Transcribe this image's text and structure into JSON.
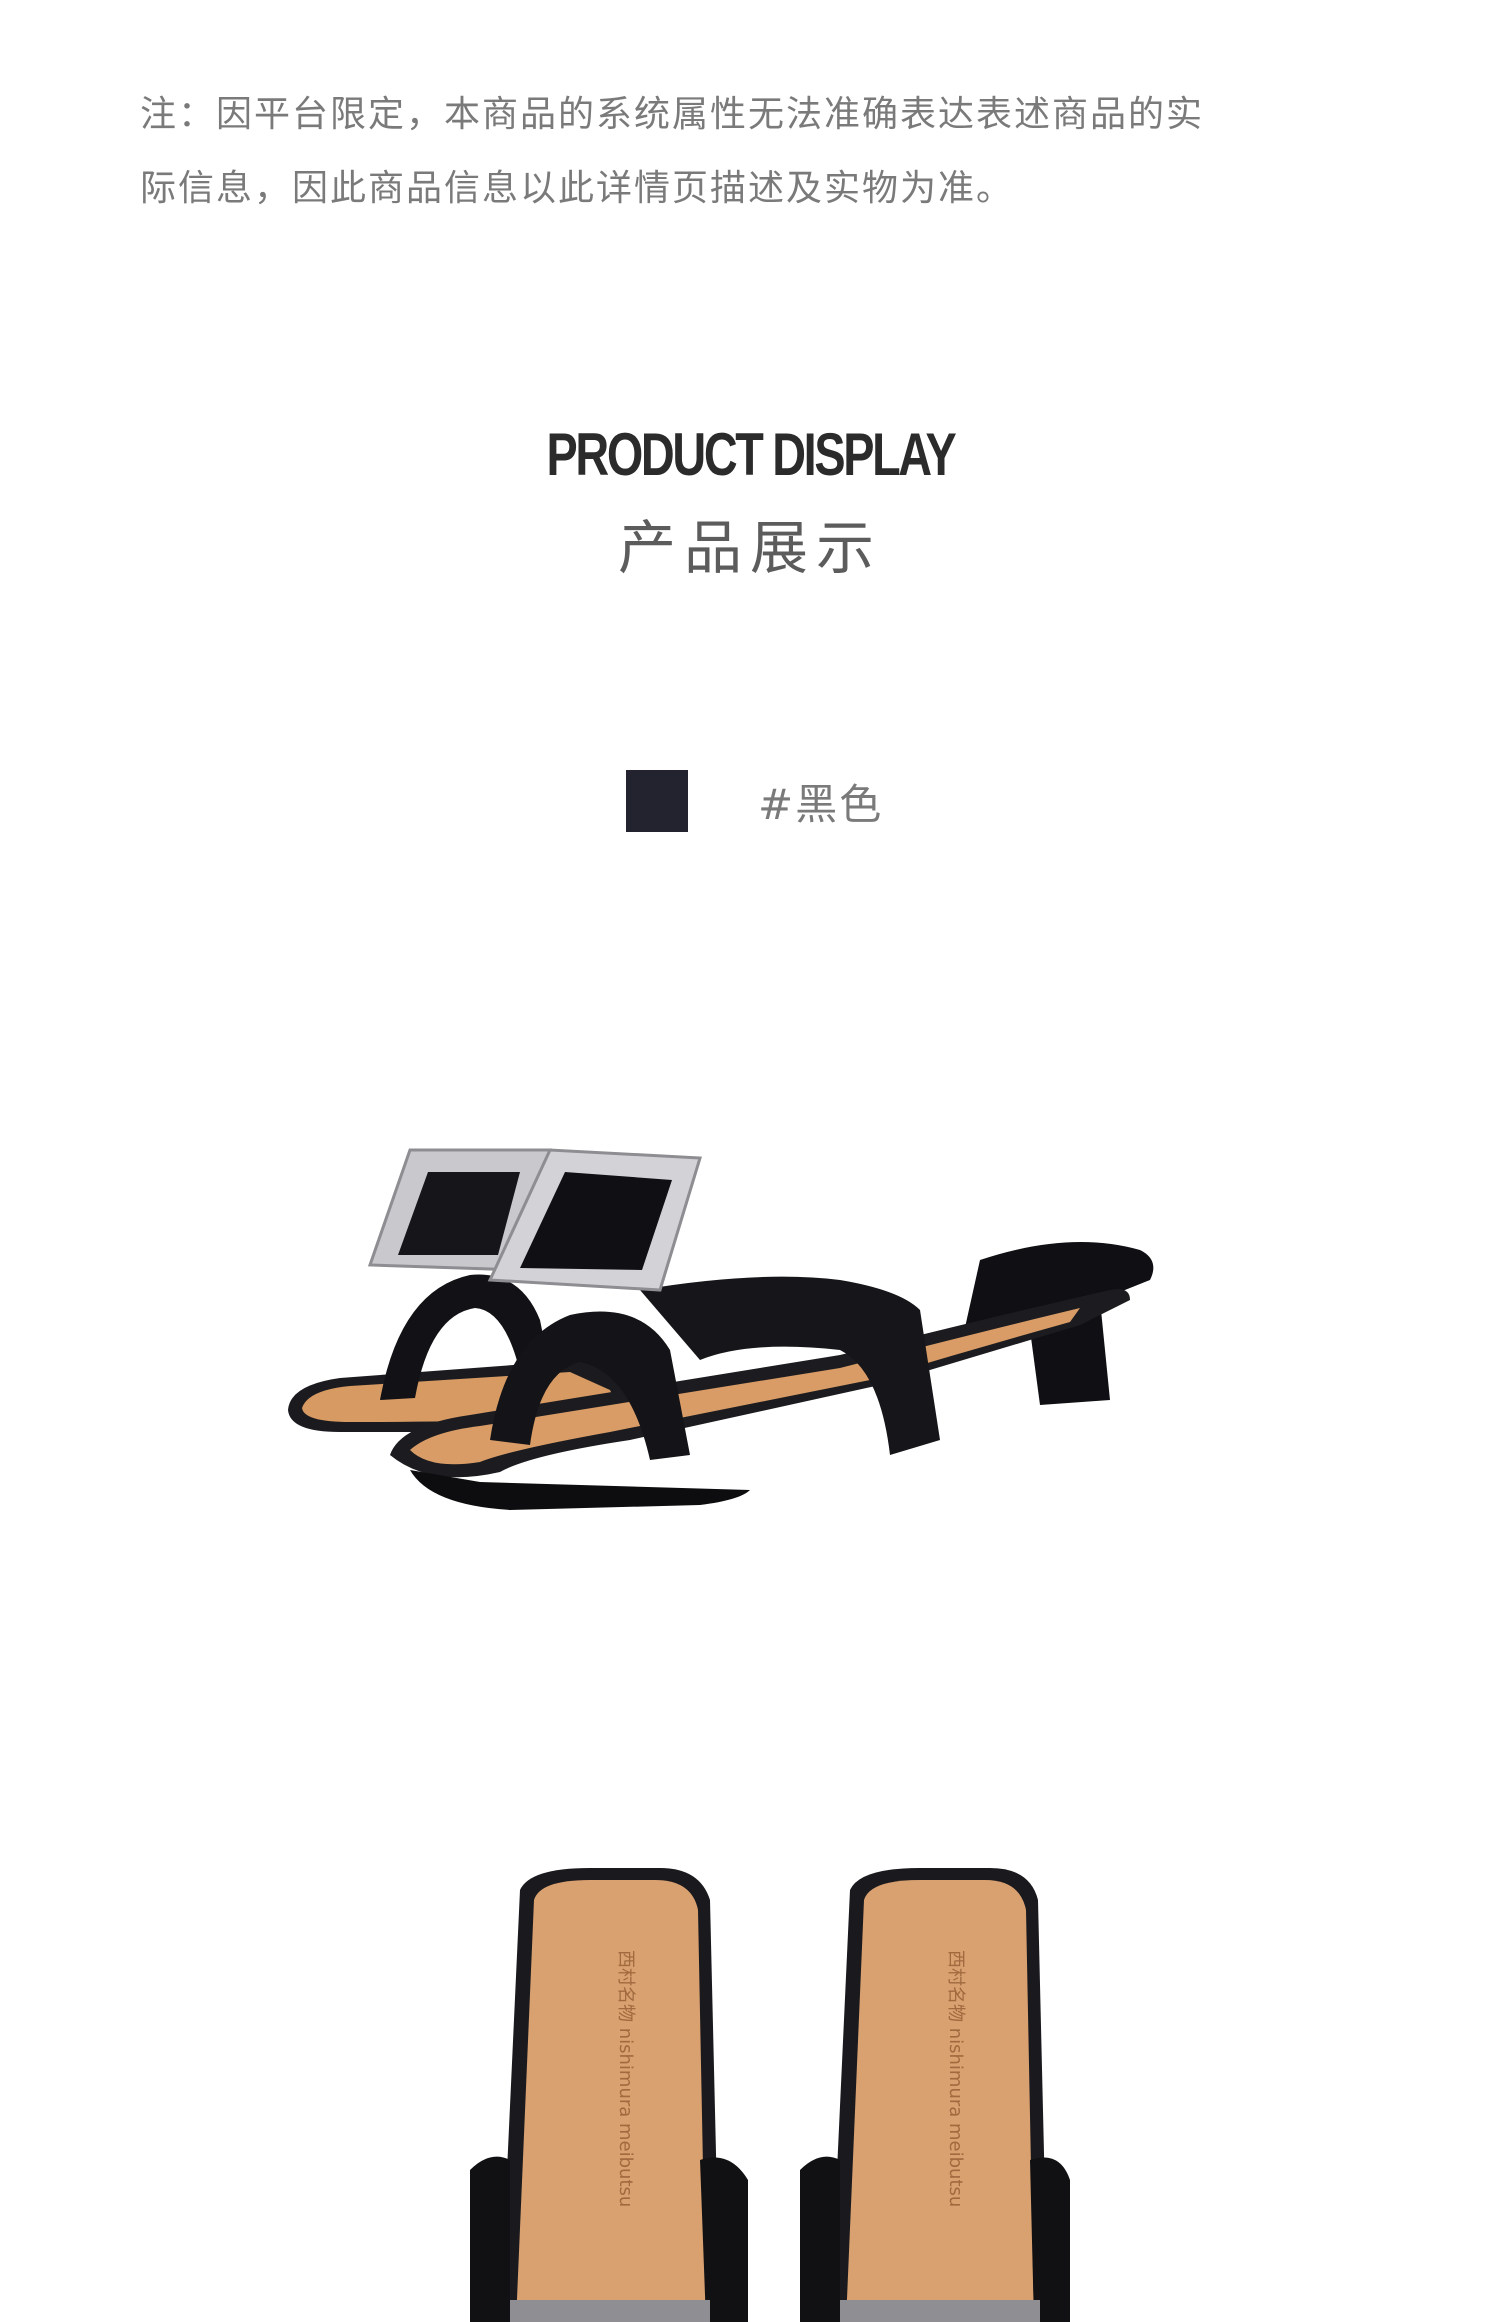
{
  "notice": {
    "line1": "注：因平台限定，本商品的系统属性无法准确表达表述商品的实",
    "line2": "际信息，因此商品信息以此详情页描述及实物为准。"
  },
  "section": {
    "title_en": "PRODUCT DISPLAY",
    "title_cn": "产品展示"
  },
  "color_option": {
    "label": "#黑色",
    "swatch_color": "#22232f"
  },
  "images": {
    "side_view": "black-slide-sandal-side-view",
    "top_view": "black-slide-sandal-top-view",
    "insole_brand_text": "西村名物 nishimura meibutsu"
  }
}
